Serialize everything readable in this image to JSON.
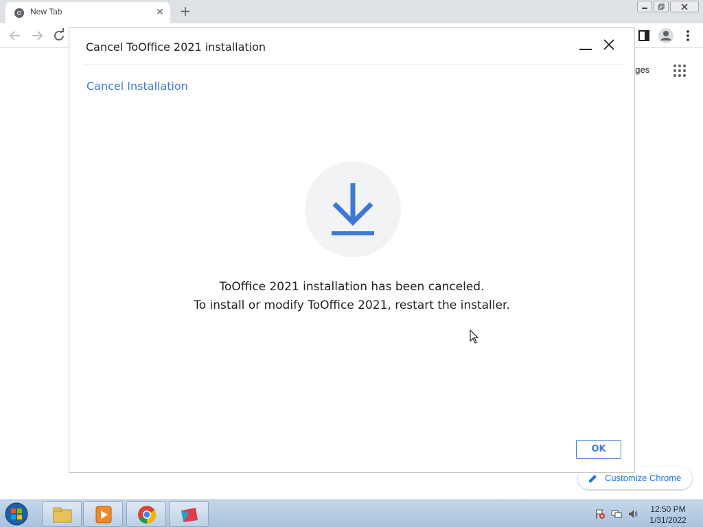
{
  "browser": {
    "tab_title": "New Tab",
    "new_tab_symbol": "+",
    "tab_close_symbol": "✕",
    "images_link": "ages",
    "customize_label": "Customize Chrome"
  },
  "dialog": {
    "title": "Cancel ToOffice 2021 installation",
    "subtitle": "Cancel Installation",
    "message_line1": "ToOffice 2021 installation has been canceled.",
    "message_line2": "To install or modify ToOffice 2021, restart the installer.",
    "ok_label": "OK",
    "accent_color": "#3d78d8"
  },
  "taskbar": {
    "apps": [
      "windows-explorer",
      "media-player",
      "chrome",
      "installer"
    ],
    "time": "12:50 PM",
    "date": "1/31/2022"
  }
}
